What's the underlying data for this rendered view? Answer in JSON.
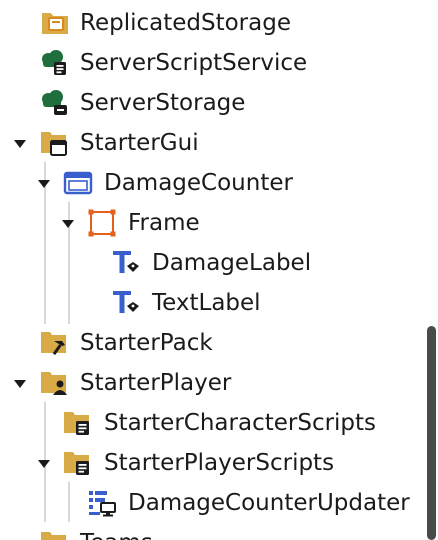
{
  "explorer": {
    "items": [
      {
        "label": "ReplicatedStorage",
        "icon": "replicated-storage-icon"
      },
      {
        "label": "ServerScriptService",
        "icon": "server-script-service-icon"
      },
      {
        "label": "ServerStorage",
        "icon": "server-storage-icon"
      },
      {
        "label": "StarterGui",
        "icon": "starter-gui-icon",
        "expanded": true
      },
      {
        "label": "DamageCounter",
        "icon": "screen-gui-icon",
        "expanded": true
      },
      {
        "label": "Frame",
        "icon": "frame-icon",
        "expanded": true
      },
      {
        "label": "DamageLabel",
        "icon": "text-label-icon"
      },
      {
        "label": "TextLabel",
        "icon": "text-label-icon"
      },
      {
        "label": "StarterPack",
        "icon": "starter-pack-icon"
      },
      {
        "label": "StarterPlayer",
        "icon": "starter-player-icon",
        "expanded": true
      },
      {
        "label": "StarterCharacterScripts",
        "icon": "script-folder-icon"
      },
      {
        "label": "StarterPlayerScripts",
        "icon": "script-folder-icon",
        "expanded": true
      },
      {
        "label": "DamageCounterUpdater",
        "icon": "local-script-icon"
      },
      {
        "label": "Teams",
        "icon": "teams-folder-icon"
      }
    ]
  },
  "colors": {
    "folder": "#d9ab47",
    "folder_tab": "#c89437",
    "service_green": "#1f6e3c",
    "gui_blue": "#3a5fcd",
    "frame_orange": "#e2611c",
    "text_blue": "#3a5fcd",
    "arrow": "#1b1b1b",
    "guide": "#d9d9d9",
    "scrollbar": "#4a4a4a"
  }
}
